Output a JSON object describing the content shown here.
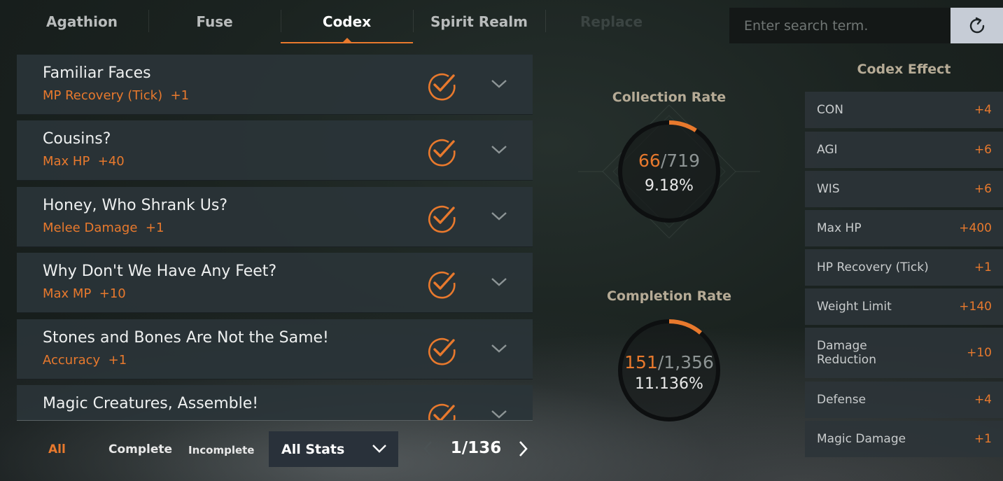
{
  "tabs": [
    {
      "label": "Agathion",
      "state": "normal"
    },
    {
      "label": "Fuse",
      "state": "normal"
    },
    {
      "label": "Codex",
      "state": "active"
    },
    {
      "label": "Spirit Realm",
      "state": "normal"
    },
    {
      "label": "Replace",
      "state": "disabled"
    }
  ],
  "search": {
    "placeholder": "Enter search term."
  },
  "codex_list": [
    {
      "title": "Familiar Faces",
      "effect": "MP Recovery (Tick)  +1",
      "completed": true
    },
    {
      "title": "Cousins?",
      "effect": "Max HP  +40",
      "completed": true
    },
    {
      "title": "Honey, Who Shrank Us?",
      "effect": "Melee Damage  +1",
      "completed": true
    },
    {
      "title": "Why Don't We Have Any Feet?",
      "effect": "Max MP  +10",
      "completed": true
    },
    {
      "title": "Stones and Bones Are Not the Same!",
      "effect": "Accuracy  +1",
      "completed": true
    },
    {
      "title": "Magic Creatures, Assemble!",
      "effect": "",
      "completed": true
    }
  ],
  "filters": {
    "all": "All",
    "complete": "Complete",
    "incomplete": "Incomplete",
    "stat_select": "All Stats"
  },
  "pager": {
    "text": "1/136"
  },
  "collection": {
    "title": "Collection Rate",
    "current": "66",
    "total": "/719",
    "percent": "9.18%",
    "progress": 0.0918
  },
  "completion": {
    "title": "Completion Rate",
    "current": "151",
    "total": "/1,356",
    "percent": "11.136%",
    "progress": 0.11136
  },
  "codex_effect": {
    "title": "Codex Effect",
    "rows": [
      {
        "name": "CON",
        "value": "+4"
      },
      {
        "name": "AGI",
        "value": "+6"
      },
      {
        "name": "WIS",
        "value": "+6"
      },
      {
        "name": "Max HP",
        "value": "+400"
      },
      {
        "name": "HP Recovery (Tick)",
        "value": "+1"
      },
      {
        "name": "Weight Limit",
        "value": "+140"
      },
      {
        "name": "Damage\nReduction",
        "value": "+10"
      },
      {
        "name": "Defense",
        "value": "+4"
      },
      {
        "name": "Magic Damage",
        "value": "+1"
      }
    ]
  },
  "colors": {
    "accent": "#e8792d",
    "panel": "#2a3438",
    "title_gold": "#b6ab96"
  },
  "icons": [
    "refresh-icon",
    "check-circle-icon",
    "chevron-down-icon",
    "chevron-left-icon",
    "chevron-right-icon"
  ]
}
